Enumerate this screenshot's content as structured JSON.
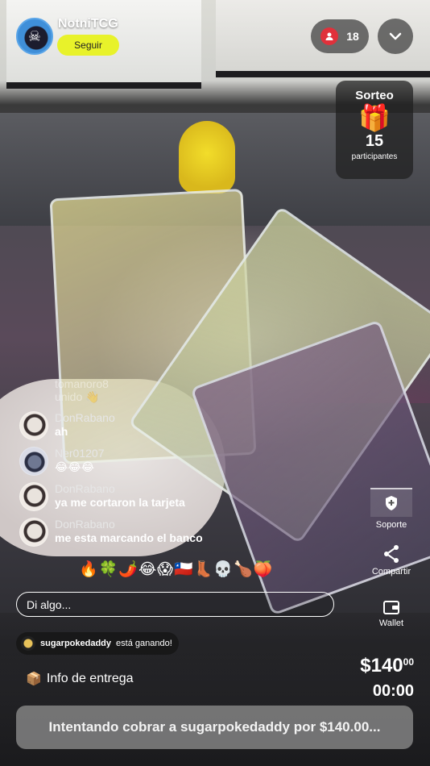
{
  "streamer": {
    "name": "NotniTCG",
    "follow_label": "Seguir"
  },
  "viewers": {
    "count": "18",
    "icon": "person-icon"
  },
  "sorteo": {
    "title": "Sorteo",
    "icon": "🎁",
    "count": "15",
    "label": "participantes"
  },
  "chat": {
    "faded_name": "tomanoro8",
    "faded_text": "unido 👋",
    "messages": [
      {
        "user": "DonRabano",
        "text": "ah"
      },
      {
        "user": "Ner01207",
        "text": "😂😂😂"
      },
      {
        "user": "DonRabano",
        "text": "ya me cortaron la tarjeta"
      },
      {
        "user": "DonRabano",
        "text": "me esta marcando el banco"
      }
    ]
  },
  "emoji_bar": "🔥🍀🌶️😂😱🇨🇱👢💀🍗🍑",
  "input": {
    "placeholder": "Di algo..."
  },
  "actions": {
    "support": "Soporte",
    "share": "Compartir",
    "wallet": "Wallet"
  },
  "winner": {
    "user": "sugarpokedaddy",
    "text": "está ganando!"
  },
  "delivery": {
    "icon": "📦",
    "label": "Info de entrega"
  },
  "auction": {
    "price": "$140",
    "cents": "00",
    "timer": "00:00"
  },
  "status_button": "Intentando cobrar a sugarpokedaddy por $140.00..."
}
